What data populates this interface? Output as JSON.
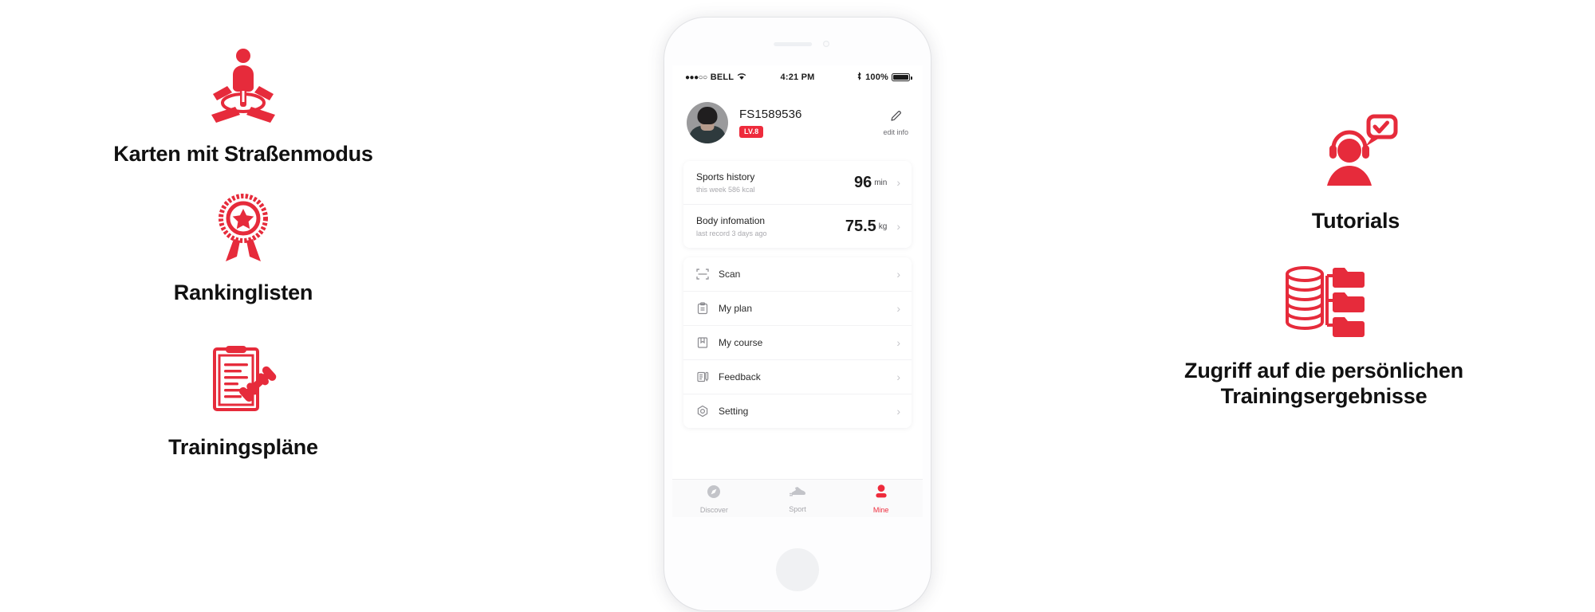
{
  "features": {
    "left": [
      {
        "id": "maps",
        "icon": "map-road-mode-icon",
        "caption": "Karten mit Straßenmodus"
      },
      {
        "id": "rankings",
        "icon": "award-rosette-icon",
        "caption": "Rankinglisten"
      },
      {
        "id": "plans",
        "icon": "clipboard-dumbbell-icon",
        "caption": "Trainingspläne"
      }
    ],
    "right": [
      {
        "id": "tutorials",
        "icon": "headset-person-check-icon",
        "caption": "Tutorials"
      },
      {
        "id": "data-access",
        "icon": "database-folders-icon",
        "caption": "Zugriff auf die persönlichen\nTrainingsergebnisse"
      }
    ]
  },
  "phone": {
    "status_bar": {
      "signal_dots": "●●●○○",
      "carrier": "BELL",
      "wifi_icon": "wifi-icon",
      "time": "4:21 PM",
      "bluetooth_icon": "bluetooth-icon",
      "battery_percent": "100%",
      "battery_icon": "battery-full-icon"
    },
    "profile": {
      "avatar_icon": "user-avatar",
      "username": "FS1589536",
      "level_badge": "LV.8",
      "edit_icon": "pencil-icon",
      "edit_label": "edit info"
    },
    "stats": [
      {
        "title": "Sports history",
        "subtitle": "this week 586 kcal",
        "value": "96",
        "unit": "min",
        "chevron": "chevron-right-icon"
      },
      {
        "title": "Body infomation",
        "subtitle": "last record 3 days ago",
        "value": "75.5",
        "unit": "kg",
        "chevron": "chevron-right-icon"
      }
    ],
    "menu": [
      {
        "label": "Scan",
        "icon": "scan-frame-icon"
      },
      {
        "label": "My plan",
        "icon": "clipboard-icon"
      },
      {
        "label": "My course",
        "icon": "book-bookmark-icon"
      },
      {
        "label": "Feedback",
        "icon": "feedback-pen-icon"
      },
      {
        "label": "Setting",
        "icon": "gear-hex-icon"
      }
    ],
    "tabs": [
      {
        "label": "Discover",
        "icon": "compass-icon",
        "active": false
      },
      {
        "label": "Sport",
        "icon": "running-shoe-icon",
        "active": false
      },
      {
        "label": "Mine",
        "icon": "person-icon",
        "active": true
      }
    ]
  },
  "colors": {
    "accent_red": "#ee2b3c",
    "icon_red": "#e62b3b",
    "text_dark": "#111111",
    "muted": "#a9a9ae"
  }
}
